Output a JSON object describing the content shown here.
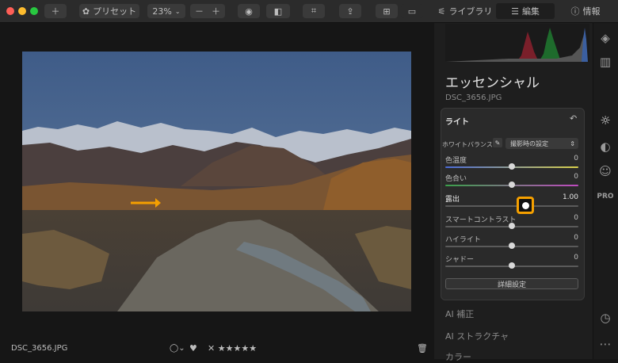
{
  "toolbar": {
    "preset_label": "プリセット",
    "zoom_label": "23%",
    "tabs": [
      {
        "label": "ライブラリ"
      },
      {
        "label": "編集"
      },
      {
        "label": "情報"
      }
    ]
  },
  "colors": {
    "accent": "#f5a000",
    "panel_bg": "#2a2a2a"
  },
  "canvas": {
    "file_name": "DSC_3656.JPG"
  },
  "panel": {
    "title": "エッセンシャル",
    "file_name": "DSC_3656.JPG",
    "section_title": "ライト",
    "white_balance": {
      "label": "ホワイトバランス",
      "value": "撮影時の設定"
    },
    "sliders": [
      {
        "label": "色温度",
        "value": "0",
        "fraction": 0.5
      },
      {
        "label": "色合い",
        "value": "0",
        "fraction": 0.5
      },
      {
        "label": "露出",
        "value": "1.00",
        "fraction": 0.6
      },
      {
        "label": "スマートコントラスト",
        "value": "0",
        "fraction": 0.5
      },
      {
        "label": "ハイライト",
        "value": "0",
        "fraction": 0.5
      },
      {
        "label": "シャドー",
        "value": "0",
        "fraction": 0.5
      }
    ],
    "advanced_button": "詳細設定",
    "menu": [
      {
        "label": "AI 補正"
      },
      {
        "label": "AI ストラクチャ"
      },
      {
        "label": "カラー"
      }
    ]
  },
  "sidebar": {
    "pro_label": "PRO"
  }
}
